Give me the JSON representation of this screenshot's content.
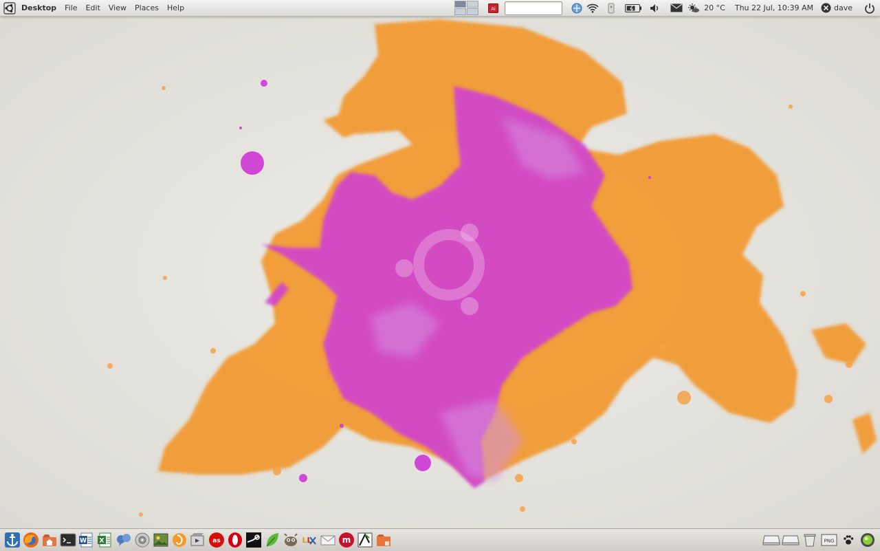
{
  "top_panel": {
    "menus": [
      "Desktop",
      "File",
      "Edit",
      "View",
      "Places",
      "Help"
    ],
    "weather": "20 °C",
    "clock": "Thu 22 Jul, 10:39 AM",
    "user": "dave",
    "search_value": ""
  },
  "launchers": [
    {
      "name": "anchor-icon"
    },
    {
      "name": "firefox-icon"
    },
    {
      "name": "home-folder-icon"
    },
    {
      "name": "terminal-icon"
    },
    {
      "name": "word-processor-icon"
    },
    {
      "name": "spreadsheet-icon"
    },
    {
      "name": "chat-icon"
    },
    {
      "name": "disk-utility-icon"
    },
    {
      "name": "image-viewer-icon"
    },
    {
      "name": "media-player-icon"
    },
    {
      "name": "video-editor-icon"
    },
    {
      "name": "lastfm-icon"
    },
    {
      "name": "opera-icon"
    },
    {
      "name": "steam-icon"
    },
    {
      "name": "leaf-icon"
    },
    {
      "name": "gimp-icon"
    },
    {
      "name": "lyx-icon"
    },
    {
      "name": "mail-icon"
    },
    {
      "name": "miro-icon"
    },
    {
      "name": "inkscape-icon"
    },
    {
      "name": "folder-icon"
    }
  ],
  "tray": {
    "png_label": "PNG"
  },
  "colors": {
    "orange": "#f2982f",
    "magenta": "#cf3fd6",
    "paper": "#e9e7e1"
  }
}
